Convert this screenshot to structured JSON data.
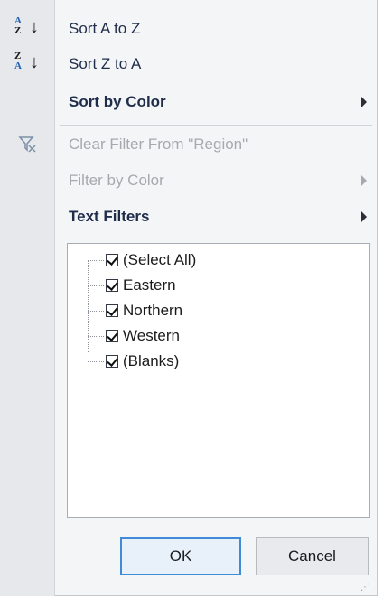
{
  "menu": {
    "sort_az": "Sort A to Z",
    "sort_za": "Sort Z to A",
    "sort_by_color": "Sort by Color",
    "clear_filter": "Clear Filter From \"Region\"",
    "filter_by_color": "Filter by Color",
    "text_filters": "Text Filters"
  },
  "icons": {
    "sort_az_top": "A",
    "sort_az_bottom": "Z",
    "sort_za_top": "Z",
    "sort_za_bottom": "A",
    "arrow_down": "↓",
    "clear_filter_icon": "funnel-x-icon"
  },
  "values": {
    "items": [
      {
        "label": "(Select All)",
        "checked": true
      },
      {
        "label": "Eastern",
        "checked": true
      },
      {
        "label": "Northern",
        "checked": true
      },
      {
        "label": "Western",
        "checked": true
      },
      {
        "label": "(Blanks)",
        "checked": true
      }
    ]
  },
  "buttons": {
    "ok": "OK",
    "cancel": "Cancel"
  },
  "colors": {
    "accent": "#3f8bd8",
    "text": "#1f2d4a",
    "disabled": "#a6a9ae"
  }
}
